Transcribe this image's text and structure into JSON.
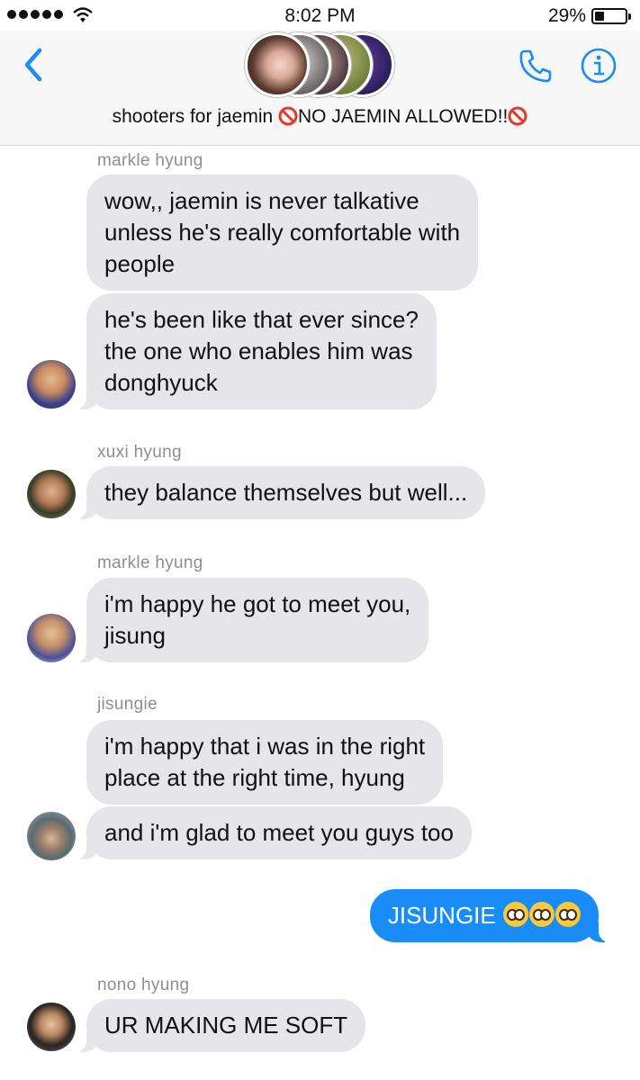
{
  "status_bar": {
    "time": "8:02 PM",
    "battery": "29%"
  },
  "header": {
    "group_name_prefix": "shooters for jaemin ",
    "group_name_main": "NO JAEMIN ALLOWED!!"
  },
  "messages": [
    {
      "sender": "markle hyung",
      "lines": [
        "wow,, jaemin is never talkative",
        "unless he's really comfortable with",
        "people"
      ]
    },
    {
      "lines": [
        "he's been like that ever since?",
        "the one who enables him was",
        "donghyuck"
      ]
    },
    {
      "sender": "xuxi hyung",
      "lines": [
        "they balance themselves but well..."
      ]
    },
    {
      "sender": "markle hyung",
      "lines": [
        "i'm happy he got to meet you,",
        "jisung"
      ]
    },
    {
      "sender": "jisungie",
      "lines": [
        "i'm happy that i was in the right",
        "place at the right time, hyung"
      ]
    },
    {
      "lines": [
        "and i'm glad to meet you guys too"
      ]
    },
    {
      "sent": true,
      "lines": [
        "JISUNGIE"
      ]
    },
    {
      "sender": "nono hyung",
      "lines": [
        "UR MAKING ME SOFT"
      ]
    }
  ],
  "colors": {
    "sent_bubble": "#1a8cf8",
    "received_bubble": "#e5e5ea",
    "accent": "#1a8cf8"
  },
  "icons": [
    "back-chevron-icon",
    "phone-icon",
    "info-icon",
    "no-entry-icon",
    "pleading-face-emoji"
  ]
}
